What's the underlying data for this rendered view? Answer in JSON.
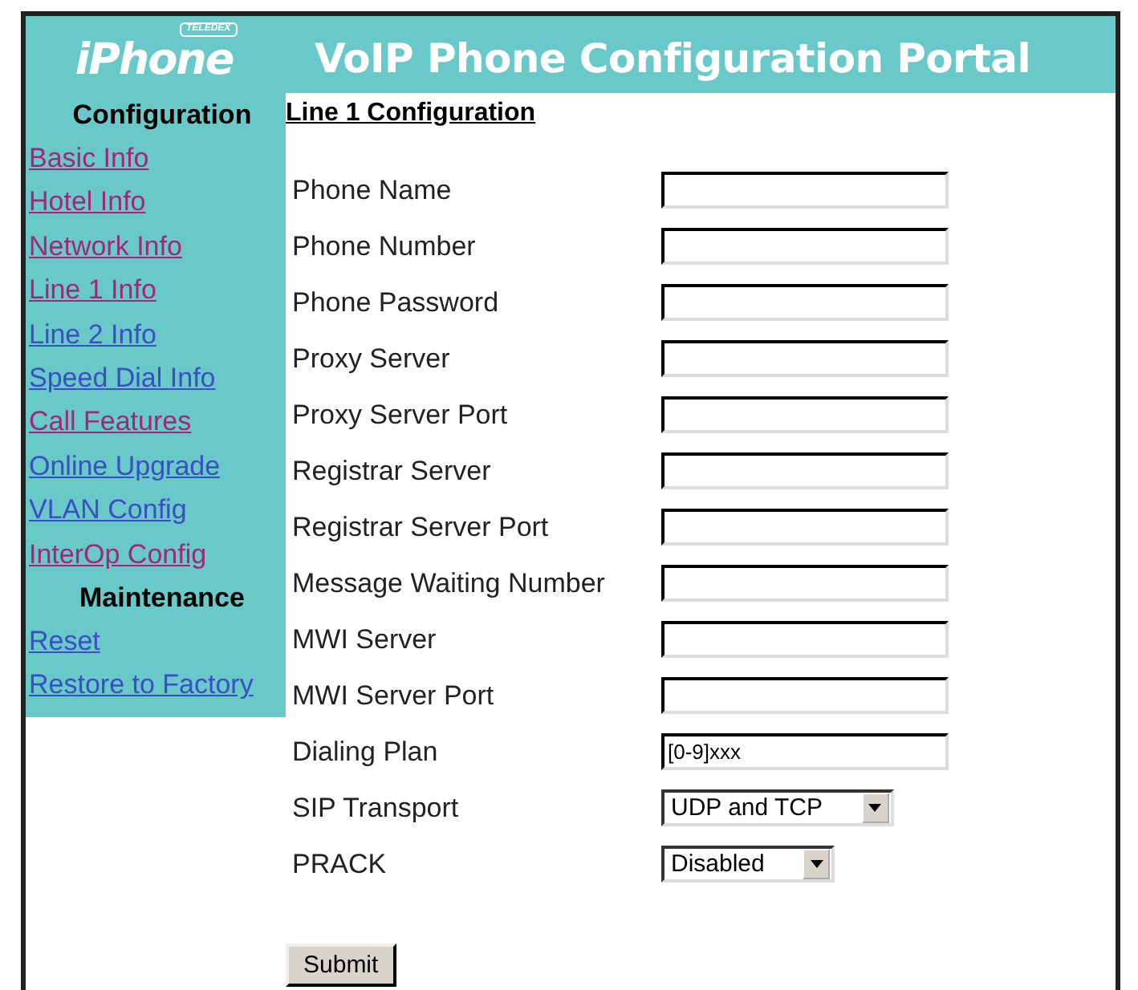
{
  "header": {
    "logo": {
      "brand": "TELEDEX",
      "name": "iPhone"
    },
    "title": "VoIP Phone Configuration Portal"
  },
  "sidebar": {
    "sections": [
      {
        "heading": "Configuration",
        "links": [
          {
            "label": "Basic Info",
            "visited": true
          },
          {
            "label": "Hotel Info",
            "visited": true
          },
          {
            "label": "Network Info",
            "visited": true
          },
          {
            "label": "Line 1 Info",
            "visited": true
          },
          {
            "label": "Line 2 Info",
            "visited": false
          },
          {
            "label": "Speed Dial Info",
            "visited": false
          },
          {
            "label": "Call Features",
            "visited": true
          },
          {
            "label": "Online Upgrade",
            "visited": false
          },
          {
            "label": "VLAN Config",
            "visited": false
          },
          {
            "label": "InterOp Config",
            "visited": true
          }
        ]
      },
      {
        "heading": "Maintenance",
        "links": [
          {
            "label": "Reset",
            "visited": false
          },
          {
            "label": "Restore to Factory",
            "visited": false
          }
        ]
      }
    ]
  },
  "form": {
    "heading": "Line 1  Configuration",
    "fields": [
      {
        "label": "Phone Name",
        "kind": "text"
      },
      {
        "label": "Phone Number",
        "kind": "text"
      },
      {
        "label": "Phone Password",
        "kind": "text"
      },
      {
        "label": "Proxy Server",
        "kind": "text"
      },
      {
        "label": "Proxy Server Port",
        "kind": "text"
      },
      {
        "label": "Registrar Server",
        "kind": "text"
      },
      {
        "label": "Registrar Server Port",
        "kind": "text"
      },
      {
        "label": "Message Waiting Number",
        "kind": "text"
      },
      {
        "label": "MWI Server",
        "kind": "text"
      },
      {
        "label": "MWI Server Port",
        "kind": "text"
      },
      {
        "label": "Dialing Plan",
        "kind": "text",
        "value": "[0-9]xxx"
      },
      {
        "label": "SIP Transport",
        "kind": "select",
        "value": "UDP and TCP"
      },
      {
        "label": "PRACK",
        "kind": "select",
        "value": "Disabled"
      }
    ],
    "submit": "Submit"
  }
}
